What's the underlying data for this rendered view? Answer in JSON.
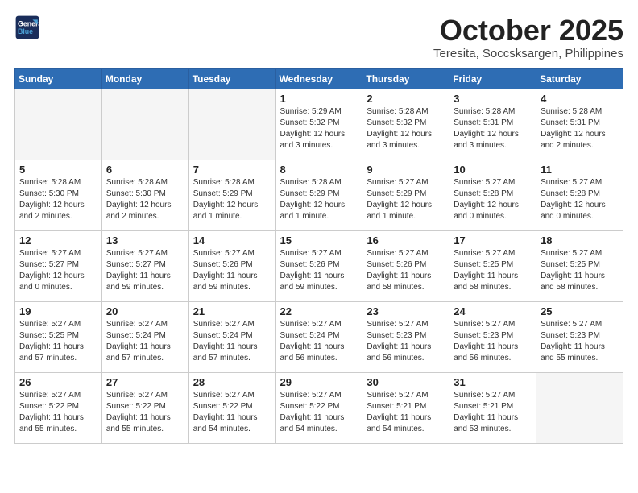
{
  "logo": {
    "line1": "General",
    "line2": "Blue"
  },
  "title": "October 2025",
  "location": "Teresita, Soccsksargen, Philippines",
  "days_of_week": [
    "Sunday",
    "Monday",
    "Tuesday",
    "Wednesday",
    "Thursday",
    "Friday",
    "Saturday"
  ],
  "weeks": [
    [
      {
        "day": "",
        "info": ""
      },
      {
        "day": "",
        "info": ""
      },
      {
        "day": "",
        "info": ""
      },
      {
        "day": "1",
        "info": "Sunrise: 5:29 AM\nSunset: 5:32 PM\nDaylight: 12 hours\nand 3 minutes."
      },
      {
        "day": "2",
        "info": "Sunrise: 5:28 AM\nSunset: 5:32 PM\nDaylight: 12 hours\nand 3 minutes."
      },
      {
        "day": "3",
        "info": "Sunrise: 5:28 AM\nSunset: 5:31 PM\nDaylight: 12 hours\nand 3 minutes."
      },
      {
        "day": "4",
        "info": "Sunrise: 5:28 AM\nSunset: 5:31 PM\nDaylight: 12 hours\nand 2 minutes."
      }
    ],
    [
      {
        "day": "5",
        "info": "Sunrise: 5:28 AM\nSunset: 5:30 PM\nDaylight: 12 hours\nand 2 minutes."
      },
      {
        "day": "6",
        "info": "Sunrise: 5:28 AM\nSunset: 5:30 PM\nDaylight: 12 hours\nand 2 minutes."
      },
      {
        "day": "7",
        "info": "Sunrise: 5:28 AM\nSunset: 5:29 PM\nDaylight: 12 hours\nand 1 minute."
      },
      {
        "day": "8",
        "info": "Sunrise: 5:28 AM\nSunset: 5:29 PM\nDaylight: 12 hours\nand 1 minute."
      },
      {
        "day": "9",
        "info": "Sunrise: 5:27 AM\nSunset: 5:29 PM\nDaylight: 12 hours\nand 1 minute."
      },
      {
        "day": "10",
        "info": "Sunrise: 5:27 AM\nSunset: 5:28 PM\nDaylight: 12 hours\nand 0 minutes."
      },
      {
        "day": "11",
        "info": "Sunrise: 5:27 AM\nSunset: 5:28 PM\nDaylight: 12 hours\nand 0 minutes."
      }
    ],
    [
      {
        "day": "12",
        "info": "Sunrise: 5:27 AM\nSunset: 5:27 PM\nDaylight: 12 hours\nand 0 minutes."
      },
      {
        "day": "13",
        "info": "Sunrise: 5:27 AM\nSunset: 5:27 PM\nDaylight: 11 hours\nand 59 minutes."
      },
      {
        "day": "14",
        "info": "Sunrise: 5:27 AM\nSunset: 5:26 PM\nDaylight: 11 hours\nand 59 minutes."
      },
      {
        "day": "15",
        "info": "Sunrise: 5:27 AM\nSunset: 5:26 PM\nDaylight: 11 hours\nand 59 minutes."
      },
      {
        "day": "16",
        "info": "Sunrise: 5:27 AM\nSunset: 5:26 PM\nDaylight: 11 hours\nand 58 minutes."
      },
      {
        "day": "17",
        "info": "Sunrise: 5:27 AM\nSunset: 5:25 PM\nDaylight: 11 hours\nand 58 minutes."
      },
      {
        "day": "18",
        "info": "Sunrise: 5:27 AM\nSunset: 5:25 PM\nDaylight: 11 hours\nand 58 minutes."
      }
    ],
    [
      {
        "day": "19",
        "info": "Sunrise: 5:27 AM\nSunset: 5:25 PM\nDaylight: 11 hours\nand 57 minutes."
      },
      {
        "day": "20",
        "info": "Sunrise: 5:27 AM\nSunset: 5:24 PM\nDaylight: 11 hours\nand 57 minutes."
      },
      {
        "day": "21",
        "info": "Sunrise: 5:27 AM\nSunset: 5:24 PM\nDaylight: 11 hours\nand 57 minutes."
      },
      {
        "day": "22",
        "info": "Sunrise: 5:27 AM\nSunset: 5:24 PM\nDaylight: 11 hours\nand 56 minutes."
      },
      {
        "day": "23",
        "info": "Sunrise: 5:27 AM\nSunset: 5:23 PM\nDaylight: 11 hours\nand 56 minutes."
      },
      {
        "day": "24",
        "info": "Sunrise: 5:27 AM\nSunset: 5:23 PM\nDaylight: 11 hours\nand 56 minutes."
      },
      {
        "day": "25",
        "info": "Sunrise: 5:27 AM\nSunset: 5:23 PM\nDaylight: 11 hours\nand 55 minutes."
      }
    ],
    [
      {
        "day": "26",
        "info": "Sunrise: 5:27 AM\nSunset: 5:22 PM\nDaylight: 11 hours\nand 55 minutes."
      },
      {
        "day": "27",
        "info": "Sunrise: 5:27 AM\nSunset: 5:22 PM\nDaylight: 11 hours\nand 55 minutes."
      },
      {
        "day": "28",
        "info": "Sunrise: 5:27 AM\nSunset: 5:22 PM\nDaylight: 11 hours\nand 54 minutes."
      },
      {
        "day": "29",
        "info": "Sunrise: 5:27 AM\nSunset: 5:22 PM\nDaylight: 11 hours\nand 54 minutes."
      },
      {
        "day": "30",
        "info": "Sunrise: 5:27 AM\nSunset: 5:21 PM\nDaylight: 11 hours\nand 54 minutes."
      },
      {
        "day": "31",
        "info": "Sunrise: 5:27 AM\nSunset: 5:21 PM\nDaylight: 11 hours\nand 53 minutes."
      },
      {
        "day": "",
        "info": ""
      }
    ]
  ]
}
